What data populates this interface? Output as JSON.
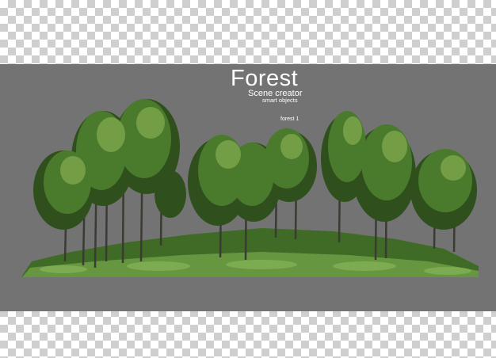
{
  "scene": {
    "title": "Forest",
    "subtitle": "Scene creator",
    "tagline": "smart objects",
    "label": "forest 1"
  },
  "colors": {
    "background_band": "#737373",
    "checker_light": "#ffffff",
    "checker_dark": "#cfcfcf",
    "foliage_dark": "#2f4f1d",
    "foliage_mid": "#4a7a2c",
    "foliage_light": "#7fa84d",
    "trunk": "#3b3b33",
    "grass": "#5a8f3a"
  }
}
